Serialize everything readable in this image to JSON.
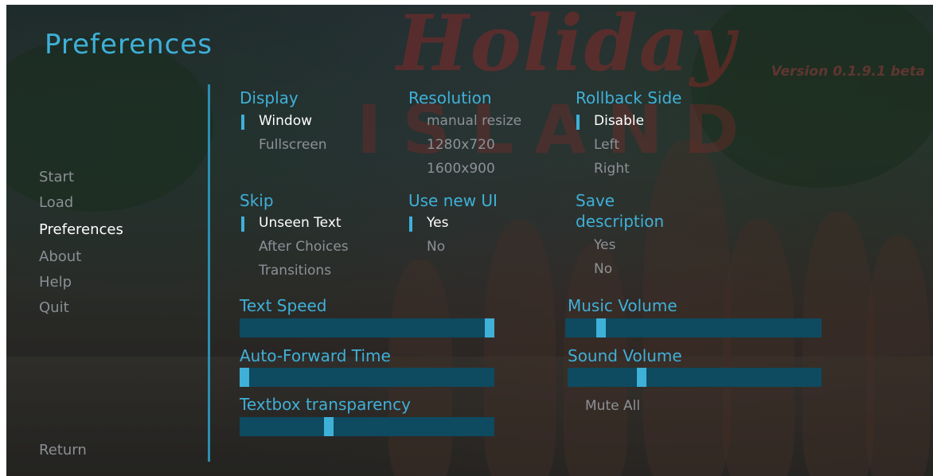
{
  "title": "Preferences",
  "version": "Version 0.1.9.1 beta",
  "logo": {
    "word": "Holiday",
    "sub": "ISLAND"
  },
  "nav": {
    "start": "Start",
    "load": "Load",
    "preferences": "Preferences",
    "about": "About",
    "help": "Help",
    "quit": "Quit",
    "return": "Return",
    "active": "Preferences"
  },
  "display": {
    "heading": "Display",
    "options": [
      "Window",
      "Fullscreen"
    ],
    "selected": "Window"
  },
  "resolution": {
    "heading": "Resolution",
    "options": [
      "manual resize",
      "1280x720",
      "1600x900"
    ],
    "selected": ""
  },
  "rollback": {
    "heading": "Rollback Side",
    "options": [
      "Disable",
      "Left",
      "Right"
    ],
    "selected": "Disable"
  },
  "skip": {
    "heading": "Skip",
    "options": [
      "Unseen Text",
      "After Choices",
      "Transitions"
    ],
    "selected": "Unseen Text"
  },
  "new_ui": {
    "heading": "Use new UI",
    "options": [
      "Yes",
      "No"
    ],
    "selected": "Yes"
  },
  "save_desc": {
    "heading_line1": "Save",
    "heading_line2": "description",
    "options": [
      "Yes",
      "No"
    ],
    "selected": ""
  },
  "sliders": {
    "text_speed": {
      "label": "Text Speed",
      "value": 0.98
    },
    "auto_forward": {
      "label": "Auto-Forward Time",
      "value": 0.02
    },
    "textbox_transparency": {
      "label": "Textbox transparency",
      "value": 0.35
    },
    "music_volume": {
      "label": "Music Volume",
      "value": 0.14
    },
    "sound_volume": {
      "label": "Sound Volume",
      "value": 0.29
    }
  },
  "mute_all": "Mute All",
  "colors": {
    "accent": "#3fb0d8",
    "bar": "#0e4a60",
    "idle_text": "#8d9196",
    "selected_text": "#ffffff"
  }
}
